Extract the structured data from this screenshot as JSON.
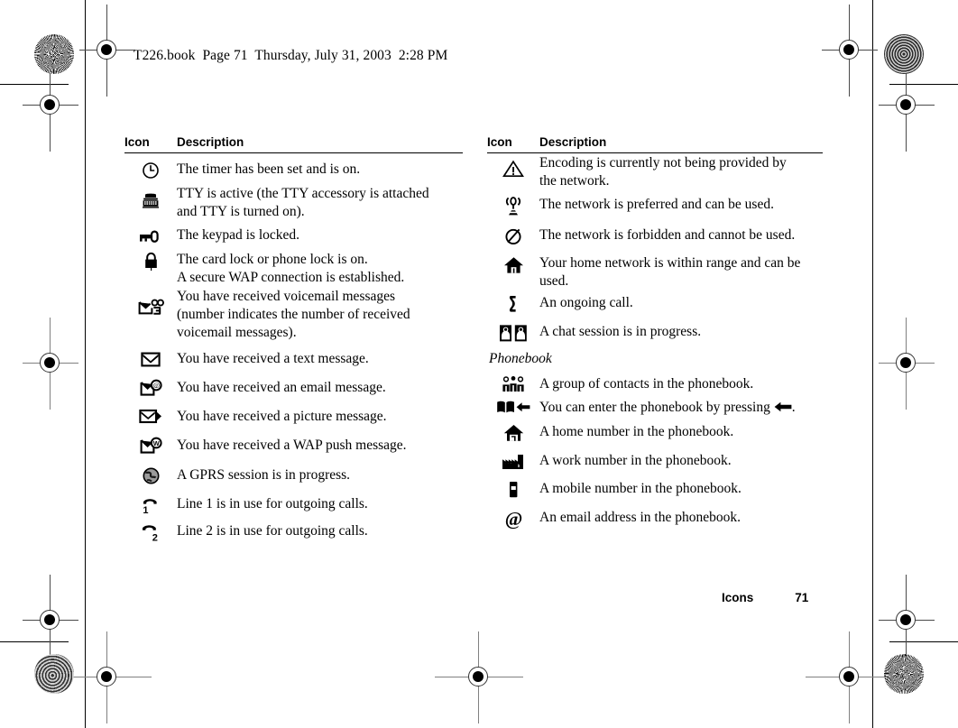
{
  "header": {
    "book_line": "T226.book  Page 71  Thursday, July 31, 2003  2:28 PM"
  },
  "footer": {
    "section": "Icons",
    "page_number": "71"
  },
  "left_table": {
    "col_icon": "Icon",
    "col_desc": "Description",
    "rows": [
      {
        "icon": "timer-clock-icon",
        "lines": [
          "The timer has been set and is on."
        ]
      },
      {
        "icon": "tty-telephone-icon",
        "lines": [
          "TTY is active (the TTY accessory is attached",
          "and TTY is turned on)."
        ]
      },
      {
        "icon": "key-keypad-lock-icon",
        "lines": [
          "The keypad is locked."
        ]
      },
      {
        "icon": "padlock-icon",
        "lines": [
          "The card lock or phone lock is on.",
          "A secure WAP connection is established."
        ]
      },
      {
        "icon": "voicemail-envelope-icon",
        "lines": [
          "You have received voicemail messages",
          "(number indicates the number of received",
          "voicemail messages)."
        ]
      },
      {
        "icon": "text-message-envelope-icon",
        "lines": [
          "You have received a text message."
        ]
      },
      {
        "icon": "email-message-icon",
        "lines": [
          "You have received an email message."
        ]
      },
      {
        "icon": "picture-message-icon",
        "lines": [
          "You have received a picture message."
        ]
      },
      {
        "icon": "wap-push-message-icon",
        "lines": [
          "You have received a WAP push message."
        ]
      },
      {
        "icon": "gprs-globe-icon",
        "lines": [
          "A GPRS session is in progress."
        ]
      },
      {
        "icon": "line-1-handset-icon",
        "lines": [
          "Line 1 is in use for outgoing calls."
        ]
      },
      {
        "icon": "line-2-handset-icon",
        "lines": [
          "Line 2 is in use for outgoing calls."
        ]
      }
    ]
  },
  "right_table": {
    "col_icon": "Icon",
    "col_desc": "Description",
    "rows": [
      {
        "icon": "warning-triangle-icon",
        "lines": [
          "Encoding is currently not being provided by",
          "the network."
        ]
      },
      {
        "icon": "network-preferred-antenna-icon",
        "lines": [
          "The network is preferred and can be used."
        ]
      },
      {
        "icon": "network-forbidden-icon",
        "lines": [
          "The network is forbidden and cannot be used."
        ]
      },
      {
        "icon": "home-network-house-icon",
        "lines": [
          "Your home network is within range and can be",
          "used."
        ]
      },
      {
        "icon": "ongoing-call-handset-icon",
        "lines": [
          "An ongoing call."
        ]
      },
      {
        "icon": "chat-session-icon",
        "lines": [
          "A chat session is in progress."
        ]
      }
    ],
    "subsection_title": "Phonebook",
    "phonebook_rows": [
      {
        "icon": "group-of-contacts-icon",
        "lines": [
          "A group of contacts in the phonebook."
        ]
      },
      {
        "icon": "open-book-arrow-icon",
        "lines": [
          "You can enter the phonebook by pressing "
        ],
        "trailing_arrow": true,
        "trailing_text": "."
      },
      {
        "icon": "home-number-house-icon",
        "lines": [
          "A home number in the phonebook."
        ]
      },
      {
        "icon": "work-number-factory-icon",
        "lines": [
          "A work number in the phonebook."
        ]
      },
      {
        "icon": "mobile-number-phone-icon",
        "lines": [
          "A mobile number in the phonebook."
        ]
      },
      {
        "icon": "email-address-at-icon",
        "lines": [
          "An email address in the phonebook."
        ]
      }
    ]
  }
}
